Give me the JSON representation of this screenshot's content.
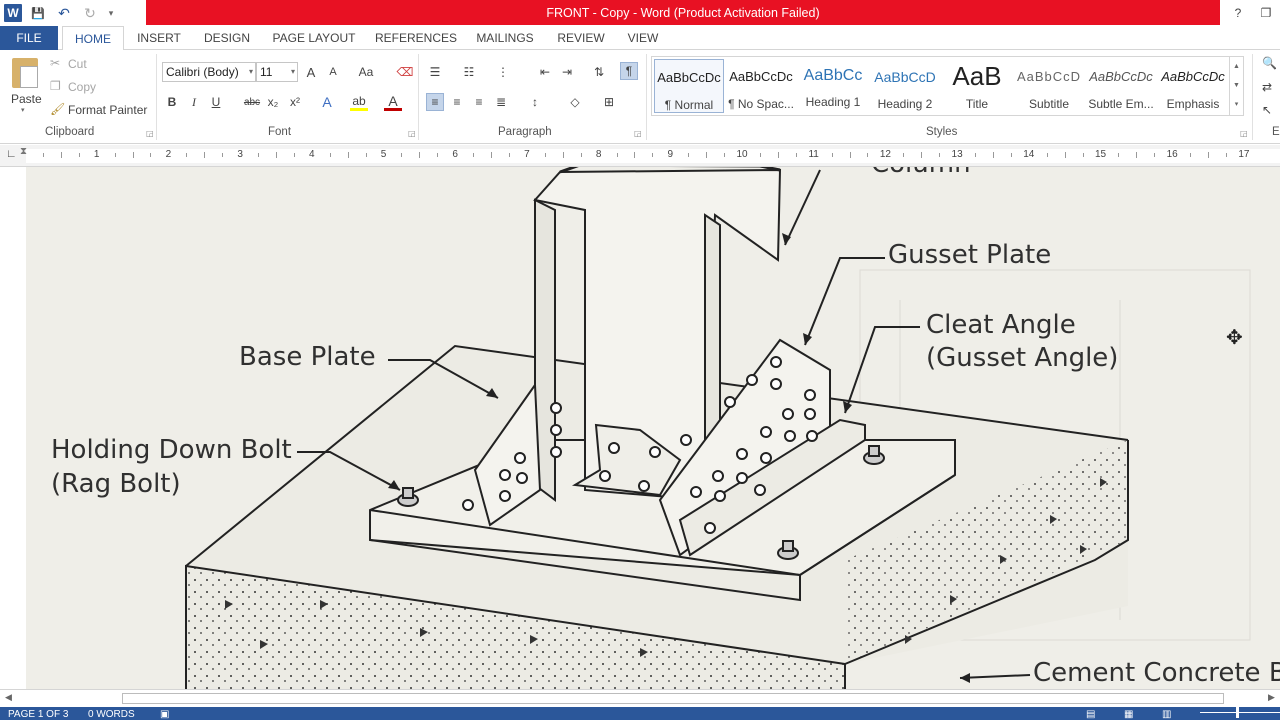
{
  "window": {
    "title": "FRONT - Copy -  Word (Product Activation Failed)",
    "help": "?",
    "minimize": "—",
    "restore": "❐"
  },
  "qat": {
    "app_letter": "W",
    "save": "💾",
    "undo": "↶",
    "redo": "↻",
    "more": "▾"
  },
  "tabs": [
    "FILE",
    "HOME",
    "INSERT",
    "DESIGN",
    "PAGE LAYOUT",
    "REFERENCES",
    "MAILINGS",
    "REVIEW",
    "VIEW"
  ],
  "clipboard": {
    "paste": "Paste",
    "cut": "Cut",
    "copy": "Copy",
    "format_painter": "Format Painter",
    "group": "Clipboard"
  },
  "font": {
    "name": "Calibri (Body)",
    "size": "11",
    "grow": "A",
    "shrink": "A",
    "case": "Aa",
    "clear": "⌫",
    "bold": "B",
    "italic": "I",
    "underline": "U",
    "strike": "abc",
    "sub": "x₂",
    "sup": "x²",
    "effects": "A",
    "highlight": "ab",
    "color": "A",
    "group": "Font"
  },
  "paragraph": {
    "group": "Paragraph",
    "pilcrow": "¶"
  },
  "styles": {
    "group": "Styles",
    "items": [
      {
        "sample": "AaBbCcDc",
        "name": "¶ Normal"
      },
      {
        "sample": "AaBbCcDc",
        "name": "¶ No Spac..."
      },
      {
        "sample": "AaBbCc",
        "name": "Heading 1"
      },
      {
        "sample": "AaBbCcD",
        "name": "Heading 2"
      },
      {
        "sample": "AaB",
        "name": "Title"
      },
      {
        "sample": "AaBbCcD",
        "name": "Subtitle"
      },
      {
        "sample": "AaBbCcDc",
        "name": "Subtle Em..."
      },
      {
        "sample": "AaBbCcDc",
        "name": "Emphasis"
      }
    ]
  },
  "editing_group": "E",
  "ruler": {
    "marks": [
      "1",
      "2",
      "3",
      "4",
      "5",
      "6",
      "7",
      "8",
      "9",
      "10",
      "11",
      "12",
      "13",
      "14",
      "15",
      "16",
      "17"
    ]
  },
  "diagram": {
    "labels": {
      "column": "Column",
      "gusset_plate": "Gusset Plate",
      "cleat_angle": "Cleat Angle",
      "gusset_angle": "(Gusset Angle)",
      "base_plate": "Base Plate",
      "holding_down_bolt": "Holding Down Bolt",
      "rag_bolt": "(Rag Bolt)",
      "cement_concrete": "Cement Concrete B"
    }
  },
  "status": {
    "page": "PAGE 1 OF 3",
    "words": "0 WORDS"
  },
  "colors": {
    "accent": "#2b579a",
    "title_alert": "#e81123"
  }
}
